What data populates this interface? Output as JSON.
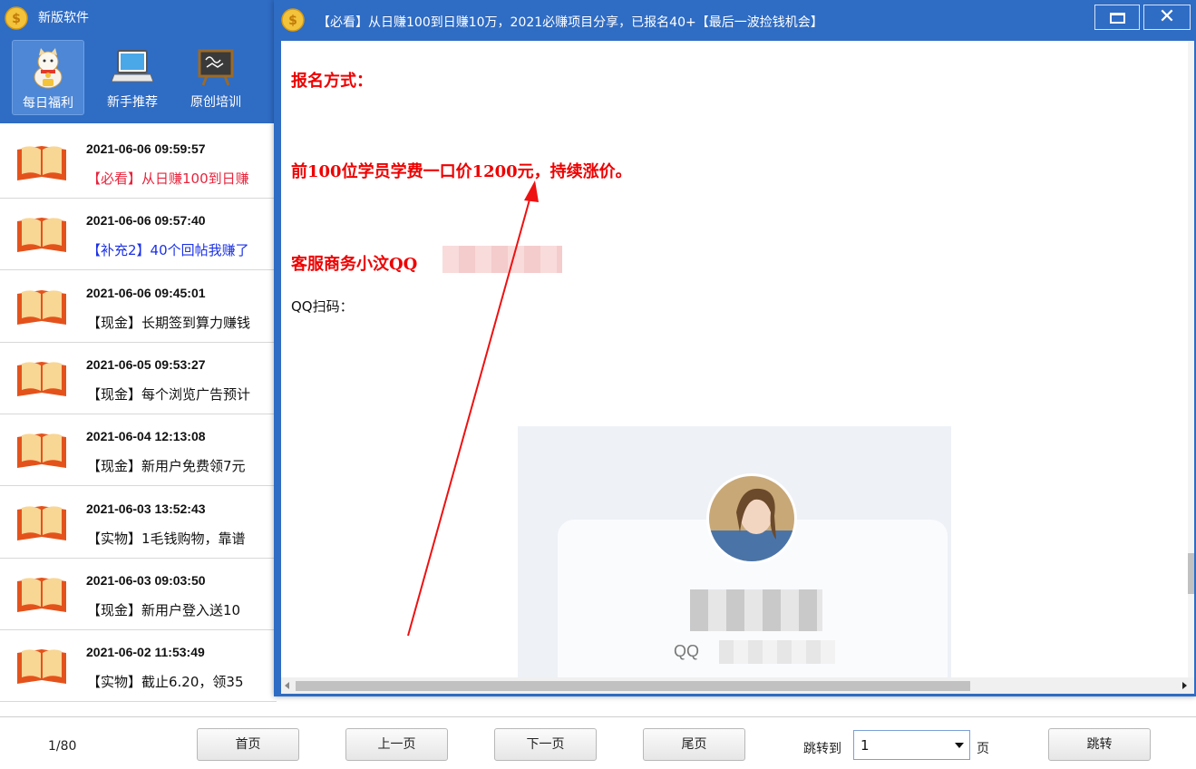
{
  "main_window": {
    "title": "新版软件",
    "toolbar": [
      {
        "label": "每日福利",
        "icon": "lucky-cat-icon",
        "active": true
      },
      {
        "label": "新手推荐",
        "icon": "laptop-icon",
        "active": false
      },
      {
        "label": "原创培训",
        "icon": "chalkboard-icon",
        "active": false
      }
    ],
    "news": [
      {
        "date": "2021-06-06 09:59:57",
        "title": "【必看】从日赚100到日赚",
        "color": "#e8243c"
      },
      {
        "date": "2021-06-06 09:57:40",
        "title": "【补充2】40个回帖我赚了",
        "color": "#1c32e6"
      },
      {
        "date": "2021-06-06 09:45:01",
        "title": "【现金】长期签到算力赚钱",
        "color": "#111111"
      },
      {
        "date": "2021-06-05 09:53:27",
        "title": "【现金】每个浏览广告预计",
        "color": "#111111"
      },
      {
        "date": "2021-06-04 12:13:08",
        "title": "【现金】新用户免费领7元",
        "color": "#111111"
      },
      {
        "date": "2021-06-03 13:52:43",
        "title": "【实物】1毛钱购物，靠谱",
        "color": "#111111"
      },
      {
        "date": "2021-06-03 09:03:50",
        "title": "【现金】新用户登入送10",
        "color": "#111111"
      },
      {
        "date": "2021-06-02 11:53:49",
        "title": "【实物】截止6.20，领35",
        "color": "#111111"
      }
    ],
    "footer": {
      "page_info": "1/80",
      "first": "首页",
      "prev": "上一页",
      "next": "下一页",
      "last": "尾页",
      "jump_label": "跳转到",
      "jump_value": "1",
      "unit": "页",
      "jump_button": "跳转"
    }
  },
  "popup": {
    "title": "【必看】从日赚100到日赚10万，2021必赚项目分享，已报名40+【最后一波捡钱机会】",
    "close_glyph": "✕",
    "content": {
      "line1": "报名方式：",
      "line2": "前100位学员学费一口价1200元，持续涨价。",
      "line3": "客服商务小汶QQ",
      "line4": "QQ扫码：",
      "qq_label": "QQ"
    }
  },
  "colors": {
    "title_blue": "#2f6cc4",
    "accent_red": "#ee0000"
  }
}
